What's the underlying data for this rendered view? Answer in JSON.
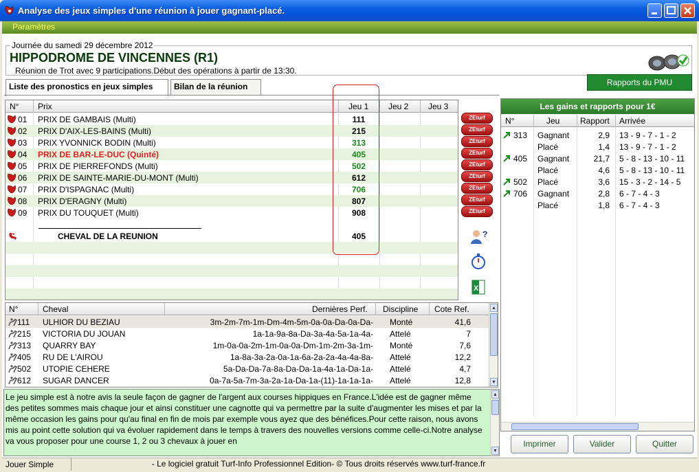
{
  "window": {
    "title": "Analyse des jeux simples d'une réunion à jouer gagnant-placé."
  },
  "menu": {
    "item": "Paramètres"
  },
  "header": {
    "date": "Journée du samedi 29 décembre 2012",
    "hippodrome": "HIPPODROME DE  VINCENNES (R1)",
    "subtitle": "Réunion de Trot avec 9 participations.Début des opérations à partir de 13:30.",
    "rapports_button": "Rapports du PMU"
  },
  "tabs": [
    {
      "label": "Liste des pronostics en jeux simples"
    },
    {
      "label": "Bilan de la réunion"
    }
  ],
  "race_table": {
    "headers": {
      "num": "N°",
      "prix": "Prix",
      "jeu1": "Jeu 1",
      "jeu2": "Jeu 2",
      "jeu3": "Jeu 3"
    },
    "rows": [
      {
        "num": "01",
        "prix": "PRIX DE GAMBAIS (Multi)",
        "jeu1": "111",
        "color": "#000000"
      },
      {
        "num": "02",
        "prix": "PRIX D'AIX-LES-BAINS (Multi)",
        "jeu1": "215",
        "color": "#000000"
      },
      {
        "num": "03",
        "prix": "PRIX YVONNICK BODIN (Multi)",
        "jeu1": "313",
        "color": "#1a8a1a"
      },
      {
        "num": "04",
        "prix": "PRIX DE BAR-LE-DUC (Quinté)",
        "jeu1": "405",
        "color": "#1a8a1a"
      },
      {
        "num": "05",
        "prix": "PRIX DE PIERREFONDS (Multi)",
        "jeu1": "502",
        "color": "#1a8a1a"
      },
      {
        "num": "06",
        "prix": "PRIX DE SAINTE-MARIE-DU-MONT (Multi)",
        "jeu1": "612",
        "color": "#000000"
      },
      {
        "num": "07",
        "prix": "PRIX D'ISPAGNAC (Multi)",
        "jeu1": "706",
        "color": "#1a8a1a"
      },
      {
        "num": "08",
        "prix": "PRIX D'ERAGNY (Multi)",
        "jeu1": "807",
        "color": "#000000"
      },
      {
        "num": "09",
        "prix": "PRIX DU TOUQUET (Multi)",
        "jeu1": "908",
        "color": "#000000"
      }
    ],
    "cheval_label": "CHEVAL DE LA REUNION",
    "cheval_value": "405"
  },
  "zeturf_label": "ZEturf",
  "horse_table": {
    "headers": {
      "num": "N°",
      "cheval": "Cheval",
      "perf": "Dernières Perf.",
      "discipline": "Discipline",
      "cote": "Cote Ref."
    },
    "rows": [
      {
        "num": "111",
        "cheval": "ULHIOR DU BEZIAU",
        "perf": "3m-2m-7m-1m-Dm-4m-5m-0a-0a-Da-0a-Da-",
        "discipline": "Monté",
        "cote": "41,6"
      },
      {
        "num": "215",
        "cheval": "VICTORIA DU JOUAN",
        "perf": "1a-1a-9a-8a-Da-3a-4a-5a-1a-4a-",
        "discipline": "Attelé",
        "cote": "7"
      },
      {
        "num": "313",
        "cheval": "QUARRY BAY",
        "perf": "1m-0a-0a-2m-1m-0a-0a-Dm-1m-2m-3a-1m-",
        "discipline": "Monté",
        "cote": "7,6"
      },
      {
        "num": "405",
        "cheval": "RU DE L'AIROU",
        "perf": "1a-8a-3a-2a-0a-1a-6a-2a-2a-4a-4a-8a-",
        "discipline": "Attelé",
        "cote": "12,2"
      },
      {
        "num": "502",
        "cheval": "UTOPIE CEHERE",
        "perf": "5a-Da-Da-7a-8a-Da-Da-1a-4a-1a-Da-1a-",
        "discipline": "Attelé",
        "cote": "4,7"
      },
      {
        "num": "612",
        "cheval": "SUGAR DANCER",
        "perf": "0a-7a-5a-7m-3a-2a-1a-Da-1a-(11)-1a-1a-1a-",
        "discipline": "Attelé",
        "cote": "12,8"
      }
    ]
  },
  "info_text": "Le jeu simple est à notre avis la seule façon de gagner de l'argent aux courses hippiques en France.L'idée est de gagner même des petites sommes mais chaque jour et ainsi constituer une cagnotte qui va permettre par la suite d'augmenter les mises et par la même occasion les gains pour qu'au final en fin de mois par exemple vous ayez que des bénéfices.Pour cette raison, nous avons mis au point cette solution qui va évoluer rapidement dans le temps à travers des nouvelles versions comme celle-ci.Notre analyse va vous proposer pour une course 1, 2 ou 3 chevaux à jouer en",
  "gains": {
    "title": "Les gains et rapports pour 1€",
    "headers": {
      "num": "N°",
      "jeu": "Jeu",
      "rapport": "Rapport",
      "arrivee": "Arrivée"
    },
    "rows": [
      {
        "num": "313",
        "jeu": "Gagnant",
        "rapport": "2,9",
        "arrivee": "13 - 9 - 7 - 1 - 2"
      },
      {
        "num": "",
        "jeu": "Placé",
        "rapport": "1,4",
        "arrivee": "13 - 9 - 7 - 1 - 2"
      },
      {
        "num": "405",
        "jeu": "Gagnant",
        "rapport": "21,7",
        "arrivee": "5 - 8 - 13 - 10 - 11"
      },
      {
        "num": "",
        "jeu": "Placé",
        "rapport": "4,6",
        "arrivee": "5 - 8 - 13 - 10 - 11"
      },
      {
        "num": "502",
        "jeu": "Placé",
        "rapport": "3,6",
        "arrivee": "15 - 3 - 2 - 14 - 5"
      },
      {
        "num": "706",
        "jeu": "Gagnant",
        "rapport": "2,8",
        "arrivee": "6 - 7 - 4 - 3"
      },
      {
        "num": "",
        "jeu": "Placé",
        "rapport": "1,8",
        "arrivee": "6 - 7 - 4 - 3"
      }
    ]
  },
  "buttons": {
    "imprimer": "Imprimer",
    "valider": "Valider",
    "quitter": "Quitter"
  },
  "status": {
    "left": "Jouer Simple",
    "center": "- Le logiciel gratuit Turf-Info Professionnel Edition- © Tous droits réservés www.turf-france.fr"
  },
  "colors": {
    "highlight_row": "#e02020",
    "green_value": "#1a8a1a",
    "header_green": "#2a7a2a"
  }
}
